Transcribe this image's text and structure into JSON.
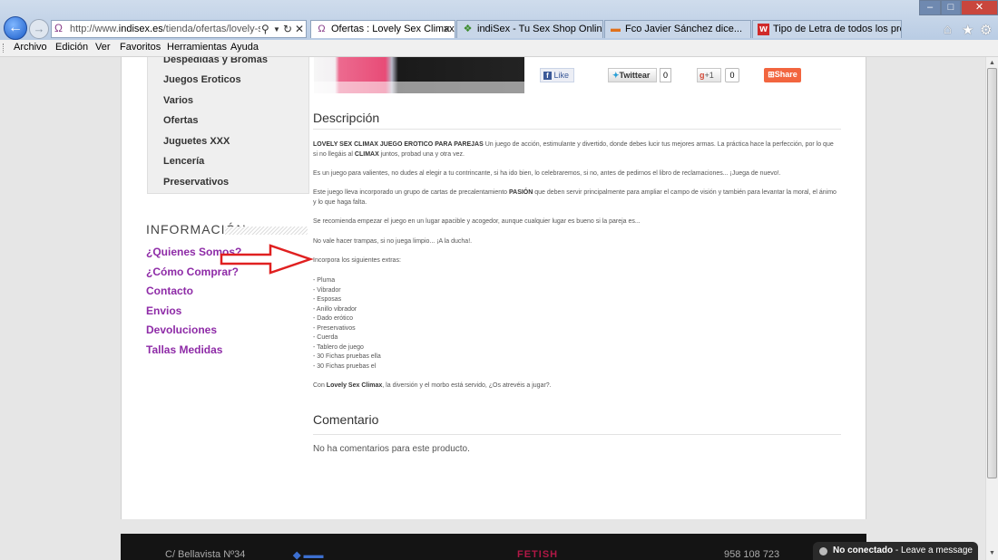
{
  "browser": {
    "url_prefix": "http://www.",
    "url_domain": "indisex.es",
    "url_path": "/tienda/ofertas/lovely-sex-",
    "tabs": [
      {
        "label": "Ofertas : Lovely Sex Climax J...",
        "active": true
      },
      {
        "label": "indiSex - Tu Sex Shop Online - ...",
        "active": false
      },
      {
        "label": "Fco Javier Sánchez dice...",
        "active": false
      },
      {
        "label": "Tipo de Letra de todos los pro...",
        "active": false
      }
    ]
  },
  "menu": {
    "items": [
      "Archivo",
      "Edición",
      "Ver",
      "Favoritos",
      "Herramientas",
      "Ayuda"
    ]
  },
  "sidebar": {
    "categories": [
      "Despedidas y Bromas",
      "Juegos Eroticos",
      "Varios",
      "Ofertas",
      "Juguetes XXX",
      "Lencería",
      "Preservativos"
    ],
    "info_title": "INFORMACIÓN",
    "info_links": [
      "¿Quienes Somos?",
      "¿Cómo Comprar?",
      "Contacto",
      "Envios",
      "Devoluciones",
      "Tallas Medidas"
    ]
  },
  "social": {
    "like": "Like",
    "twitter": "Twittear",
    "twitter_count": "0",
    "gplus": "+1",
    "gplus_count": "0",
    "share": "Share"
  },
  "description": {
    "title": "Descripción",
    "p1_bold": "LOVELY SEX CLIMAX JUEGO EROTICO PARA PAREJAS",
    "p1_a": " Un juego de acción, estimulante y divertido, donde debes lucir tus mejores armas. La práctica hace la perfección, por lo que si no llegáis al ",
    "p1_bold2": "CLIMAX",
    "p1_b": " juntos, probad una y otra vez.",
    "p2": "Es un juego para valientes, no dudes al elegir a tu contrincante, si ha ido bien, lo celebraremos, si no, antes de pedirnos el libro de reclamaciones... ¡Juega de nuevo!.",
    "p3_a": "Este juego lleva incorporado un grupo de cartas de precalentamiento ",
    "p3_bold": "PASIÓN",
    "p3_b": " que deben servir principalmente para ampliar el campo de visión y también para levantar la moral, el ánimo y lo que haga falta.",
    "p4": "Se recomienda empezar el juego en un lugar apacible y acogedor, aunque cualquier lugar es bueno si la pareja es...",
    "p5": "No vale hacer trampas, si no juega limpio... ¡A la ducha!.",
    "p6": "Incorpora los siguientes extras:",
    "extras": [
      "- Pluma",
      "- Vibrador",
      "- Esposas",
      "- Anillo vibrador",
      "- Dado erótico",
      "- Preservativos",
      "- Cuerda",
      "- Tablero de juego",
      "- 30 Fichas pruebas ella",
      "- 30 Fichas pruebas el"
    ],
    "p7_a": "Con ",
    "p7_bold": "Lovely Sex Climax",
    "p7_b": ", la diversión y el morbo está servido, ¿Os atrevéis a jugar?."
  },
  "comments": {
    "title": "Comentario",
    "empty": "No ha comentarios para este producto."
  },
  "footer": {
    "address": "C/ Bellavista Nº34",
    "logo_text": "FETISH",
    "phone": "958 108 723"
  },
  "chat": {
    "status": "No conectado",
    "action": " - Leave a message"
  },
  "colors": {
    "link_purple": "#8e2ba7",
    "share_orange": "#f2653f",
    "arrow_red": "#e02020"
  }
}
